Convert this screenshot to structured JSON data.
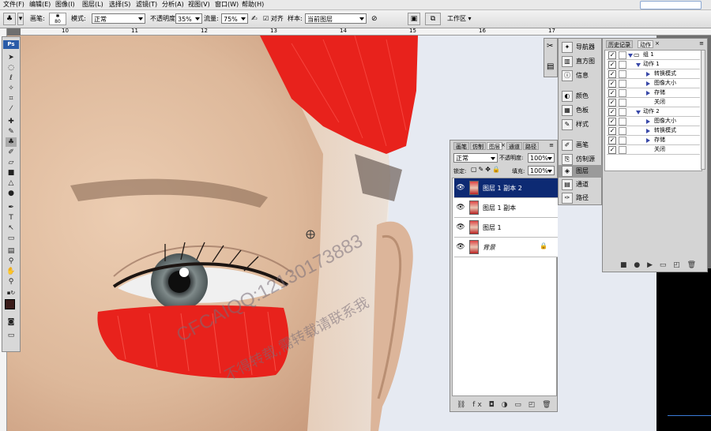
{
  "menu": {
    "items": [
      "文件(F)",
      "编辑(E)",
      "图像(I)",
      "图层(L)",
      "选择(S)",
      "滤镜(T)",
      "分析(A)",
      "视图(V)",
      "窗口(W)",
      "帮助(H)"
    ]
  },
  "options_bar": {
    "brush_label": "画笔:",
    "brush_size": "80",
    "mode_label": "模式:",
    "mode_value": "正常",
    "opacity_label": "不透明度:",
    "opacity_value": "35%",
    "flow_label": "流量:",
    "flow_value": "75%",
    "aligned_label": "对齐",
    "sample_label": "样本:",
    "sample_value": "当前图层",
    "workspace_label": "工作区"
  },
  "ruler": {
    "numbers": [
      "10",
      "11",
      "12",
      "13",
      "14",
      "15",
      "16",
      "17"
    ]
  },
  "toolbox": {
    "logo": "Ps"
  },
  "side_panel_a": {
    "items": [
      {
        "icon": "navigator-icon",
        "glyph": "✦",
        "label": "导航器"
      },
      {
        "icon": "histogram-icon",
        "glyph": "▥",
        "label": "直方图"
      },
      {
        "icon": "info-icon",
        "glyph": "ⓘ",
        "label": "信息"
      },
      {
        "icon": "color-icon",
        "glyph": "◐",
        "label": "颜色"
      },
      {
        "icon": "swatches-icon",
        "glyph": "▦",
        "label": "色板"
      },
      {
        "icon": "styles-icon",
        "glyph": "✎",
        "label": "样式"
      },
      {
        "icon": "brushes-icon",
        "glyph": "✐",
        "label": "画笔"
      },
      {
        "icon": "clone-source-icon",
        "glyph": "⎘",
        "label": "仿制源"
      },
      {
        "icon": "layers-icon",
        "glyph": "◈",
        "label": "图层"
      },
      {
        "icon": "channels-icon",
        "glyph": "▤",
        "label": "通道"
      },
      {
        "icon": "paths-icon",
        "glyph": "✑",
        "label": "路径"
      }
    ]
  },
  "layers_panel": {
    "tabs": [
      "画笔",
      "仿制",
      "图层",
      "通道",
      "路径"
    ],
    "blend_mode": "正常",
    "opacity_label": "不透明度:",
    "opacity_value": "100%",
    "lock_label": "锁定:",
    "fill_label": "填充:",
    "fill_value": "100%",
    "layers": [
      {
        "name": "图层 1 副本 2",
        "active": true,
        "locked": false
      },
      {
        "name": "图层 1 副本",
        "active": false,
        "locked": false
      },
      {
        "name": "图层 1",
        "active": false,
        "locked": false
      },
      {
        "name": "背景",
        "active": false,
        "locked": true
      }
    ],
    "footer_icons": "⛓ fx ◘ ◑ ▭ ◰ 🗑"
  },
  "history_panel": {
    "tabs": [
      "历史记录",
      "动作"
    ],
    "rows": [
      {
        "level": 0,
        "label": "组 1",
        "expanded": true,
        "folder": true
      },
      {
        "level": 1,
        "label": "动作 1",
        "expanded": true
      },
      {
        "level": 2,
        "label": "转换模式"
      },
      {
        "level": 2,
        "label": "图像大小"
      },
      {
        "level": 2,
        "label": "存储"
      },
      {
        "level": 2,
        "label": "关闭"
      },
      {
        "level": 1,
        "label": "动作 2",
        "expanded": true
      },
      {
        "level": 2,
        "label": "图像大小"
      },
      {
        "level": 2,
        "label": "转换模式"
      },
      {
        "level": 2,
        "label": "存储"
      },
      {
        "level": 2,
        "label": "关闭"
      }
    ],
    "footer_icons": "■ ● ▶ ▭ ◰ 🗑"
  },
  "watermark": {
    "line1": "CFCAIQQ:12130173883",
    "line2": "不得转载,需转载请联系我"
  },
  "colors": {
    "active_layer": "#0d2a73",
    "lash_red": "#e8221c",
    "skin": "#e2c1a6"
  }
}
